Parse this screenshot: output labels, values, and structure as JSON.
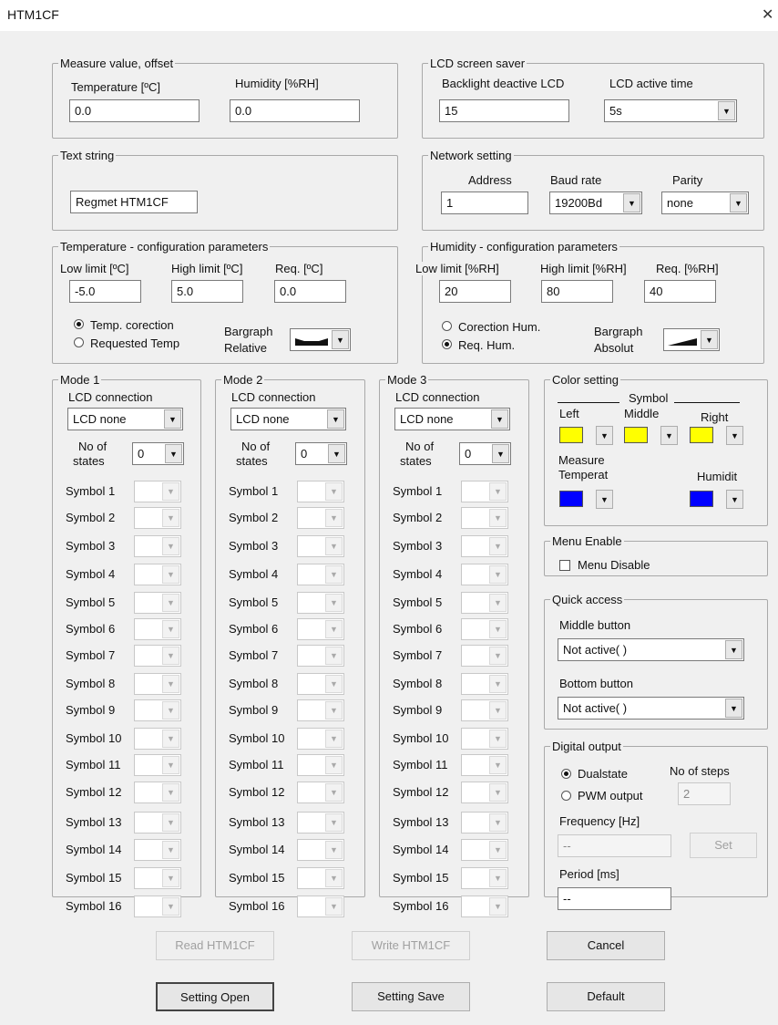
{
  "window": {
    "title": "HTM1CF",
    "close": "✕"
  },
  "measure": {
    "legend": "Measure value, offset",
    "temp_label": "Temperature [ºC]",
    "hum_label": "Humidity [%RH]",
    "temp_value": "0.0",
    "hum_value": "0.0"
  },
  "lcd_saver": {
    "legend": "LCD screen saver",
    "backlight_label": "Backlight deactive LCD",
    "active_label": "LCD active time",
    "backlight_value": "15",
    "active_value": "5s"
  },
  "text_string": {
    "legend": "Text string",
    "value": "Regmet HTM1CF"
  },
  "network": {
    "legend": "Network setting",
    "address_label": "Address",
    "baud_label": "Baud rate",
    "parity_label": "Parity",
    "address_value": "1",
    "baud_value": "19200Bd",
    "parity_value": "none"
  },
  "temp_cfg": {
    "legend": "Temperature - configuration parameters",
    "low_label": "Low limit [ºC]",
    "high_label": "High limit [ºC]",
    "req_label": "Req. [ºC]",
    "low_value": "-5.0",
    "high_value": "5.0",
    "req_value": "0.0",
    "radio1": "Temp. corection",
    "radio2": "Requested Temp",
    "bargraph_label": "Bargraph",
    "bargraph_mode": "Relative"
  },
  "hum_cfg": {
    "legend": "Humidity - configuration parameters",
    "low_label": "Low limit [%RH]",
    "high_label": "High limit [%RH]",
    "req_label": "Req. [%RH]",
    "low_value": "20",
    "high_value": "80",
    "req_value": "40",
    "radio1": "Corection Hum.",
    "radio2": "Req. Hum.",
    "bargraph_label": "Bargraph",
    "bargraph_mode": "Absolut"
  },
  "modes": [
    {
      "legend": "Mode 1",
      "lcd_label": "LCD connection",
      "lcd_value": "LCD none",
      "states_label1": "No of",
      "states_label2": "states",
      "states_value": "0"
    },
    {
      "legend": "Mode 2",
      "lcd_label": "LCD connection",
      "lcd_value": "LCD none",
      "states_label1": "No of",
      "states_label2": "states",
      "states_value": "0"
    },
    {
      "legend": "Mode 3",
      "lcd_label": "LCD connection",
      "lcd_value": "LCD none",
      "states_label1": "No of",
      "states_label2": "states",
      "states_value": "0"
    }
  ],
  "symbols": [
    "Symbol 1",
    "Symbol 2",
    "Symbol 3",
    "Symbol 4",
    "Symbol 5",
    "Symbol 6",
    "Symbol 7",
    "Symbol 8",
    "Symbol 9",
    "Symbol 10",
    "Symbol 11",
    "Symbol 12",
    "Symbol 13",
    "Symbol 14",
    "Symbol 15",
    "Symbol 16"
  ],
  "color_setting": {
    "legend": "Color setting",
    "symbol_label": "Symbol",
    "left_label": "Left",
    "middle_label": "Middle",
    "right_label": "Right",
    "measure_label": "Measure",
    "temperat_label": "Temperat",
    "humidit_label": "Humidit",
    "yellow": "#ffff00",
    "blue": "#0000ff"
  },
  "menu_enable": {
    "legend": "Menu Enable",
    "checkbox_label": "Menu Disable"
  },
  "quick_access": {
    "legend": "Quick access",
    "middle_label": "Middle button",
    "middle_value": "Not active( )",
    "bottom_label": "Bottom button",
    "bottom_value": "Not active( )"
  },
  "digital_output": {
    "legend": "Digital output",
    "radio1": "Dualstate",
    "radio2": "PWM output",
    "steps_label": "No of steps",
    "steps_value": "2",
    "freq_label": "Frequency [Hz]",
    "freq_value": "--",
    "set_label": "Set",
    "period_label": "Period [ms]",
    "period_value": "--"
  },
  "buttons": {
    "read": "Read HTM1CF",
    "write": "Write HTM1CF",
    "cancel": "Cancel",
    "open": "Setting Open",
    "save": "Setting Save",
    "default": "Default"
  },
  "arrow_glyph": "▼"
}
